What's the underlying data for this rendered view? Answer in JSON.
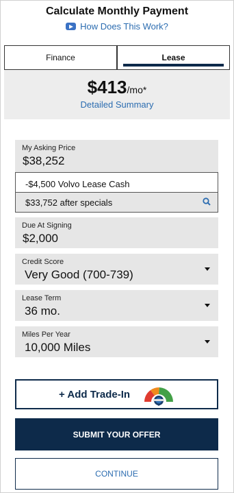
{
  "header": {
    "title": "Calculate Monthly Payment",
    "how_link": "How Does This Work?"
  },
  "tabs": [
    {
      "label": "Finance",
      "active": false
    },
    {
      "label": "Lease",
      "active": true
    }
  ],
  "summary": {
    "price": "$413",
    "suffix": "/mo*",
    "detailed_link": "Detailed Summary"
  },
  "asking_price": {
    "label": "My Asking Price",
    "value": "$38,252"
  },
  "lease_cash": {
    "text": "-$4,500 Volvo Lease Cash"
  },
  "after_specials": {
    "text": "$33,752 after specials"
  },
  "due_at_signing": {
    "label": "Due At Signing",
    "value": "$2,000"
  },
  "credit_score": {
    "label": "Credit Score",
    "value": "Very Good (700-739)"
  },
  "lease_term": {
    "label": "Lease Term",
    "value": "36 mo."
  },
  "miles_per_year": {
    "label": "Miles Per Year",
    "value": "10,000 Miles"
  },
  "trade_in": {
    "label": "+ Add Trade-In"
  },
  "buttons": {
    "submit": "SUBMIT YOUR OFFER",
    "continue": "CONTINUE"
  },
  "colors": {
    "navy": "#0d2a4a",
    "link_blue": "#2b6cb0",
    "field_gray": "#e6e6e6"
  }
}
